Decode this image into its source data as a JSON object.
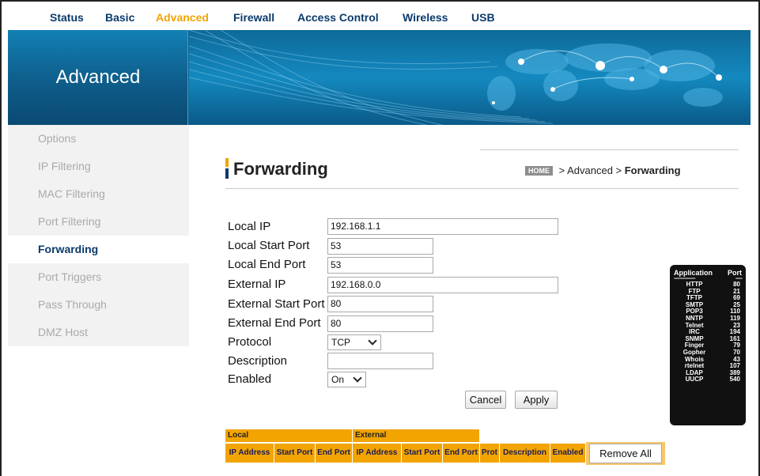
{
  "nav": {
    "tabs": [
      {
        "label": "Status"
      },
      {
        "label": "Basic"
      },
      {
        "label": "Advanced"
      },
      {
        "label": "Firewall"
      },
      {
        "label": "Access Control"
      },
      {
        "label": "Wireless"
      },
      {
        "label": "USB"
      }
    ],
    "active_tab": "Advanced"
  },
  "banner": {
    "section_title": "Advanced"
  },
  "sidebar": {
    "items": [
      {
        "label": "Options"
      },
      {
        "label": "IP Filtering"
      },
      {
        "label": "MAC Filtering"
      },
      {
        "label": "Port Filtering"
      },
      {
        "label": "Forwarding"
      },
      {
        "label": "Port Triggers"
      },
      {
        "label": "Pass Through"
      },
      {
        "label": "DMZ Host"
      }
    ],
    "active_item": "Forwarding"
  },
  "page": {
    "title": "Forwarding",
    "breadcrumb": {
      "home": "HOME",
      "parent": " > Advanced > ",
      "current": "Forwarding"
    }
  },
  "form": {
    "local_ip": {
      "label": "Local IP",
      "value": "192.168.1.1"
    },
    "local_start_port": {
      "label": "Local Start Port",
      "value": "53"
    },
    "local_end_port": {
      "label": "Local End Port",
      "value": "53"
    },
    "external_ip": {
      "label": "External IP",
      "value": "192.168.0.0"
    },
    "external_start_port": {
      "label": "External Start Port",
      "value": "80"
    },
    "external_end_port": {
      "label": "External End Port",
      "value": "80"
    },
    "protocol": {
      "label": "Protocol",
      "value": "TCP"
    },
    "description": {
      "label": "Description",
      "value": ""
    },
    "enabled": {
      "label": "Enabled",
      "value": "On"
    },
    "cancel_label": "Cancel",
    "apply_label": "Apply"
  },
  "ports_reference": {
    "header_app": "Application",
    "header_port": "Port",
    "dash_app": "--------------------",
    "dash_port": "------",
    "rows": [
      {
        "app": "HTTP",
        "port": "80"
      },
      {
        "app": "FTP",
        "port": "21"
      },
      {
        "app": "TFTP",
        "port": "69"
      },
      {
        "app": "SMTP",
        "port": "25"
      },
      {
        "app": "POP3",
        "port": "110"
      },
      {
        "app": "NNTP",
        "port": "119"
      },
      {
        "app": "Telnet",
        "port": "23"
      },
      {
        "app": "IRC",
        "port": "194"
      },
      {
        "app": "SNMP",
        "port": "161"
      },
      {
        "app": "Finger",
        "port": "79"
      },
      {
        "app": "Gopher",
        "port": "70"
      },
      {
        "app": "Whois",
        "port": "43"
      },
      {
        "app": "rtelnet",
        "port": "107"
      },
      {
        "app": "LDAP",
        "port": "389"
      },
      {
        "app": "UUCP",
        "port": "540"
      }
    ]
  },
  "table": {
    "group_local": "Local",
    "group_external": "External",
    "columns": [
      "IP Address",
      "Start Port",
      "End Port",
      "IP Address",
      "Start Port",
      "End Port",
      "Prot",
      "Description",
      "Enabled"
    ],
    "remove_all_label": "Remove All"
  },
  "colors": {
    "accent": "#f2a400",
    "navy": "#0a3a6b",
    "banner": "#0e5d8a"
  }
}
